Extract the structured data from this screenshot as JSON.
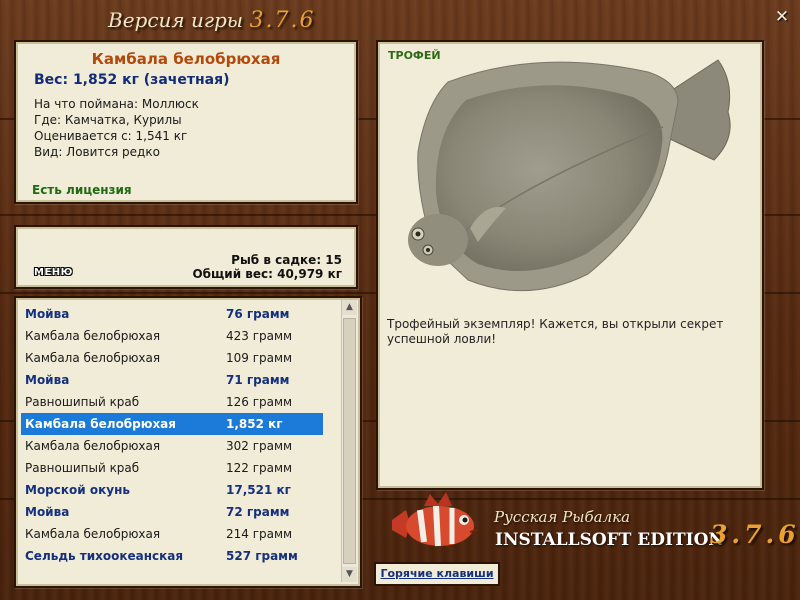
{
  "title": {
    "text": "Версия игры",
    "version": "3.7.6"
  },
  "fish_info": {
    "name": "Камбала белобрюхая",
    "weight_line": "Вес: 1,852 кг (зачетная)",
    "bait": "На что поймана: Моллюск",
    "location": "Где: Камчатка, Курилы",
    "rated_from": "Оценивается с: 1,541 кг",
    "kind": "Вид: Ловится редко",
    "license": "Есть лицензия"
  },
  "cage": {
    "fish_count": "Рыб в садке: 15",
    "total_weight": "Общий вес: 40,979 кг",
    "menu_label": "МЕНЮ"
  },
  "catch_list": [
    {
      "name": "Мойва",
      "weight": "76 грамм",
      "bold": true
    },
    {
      "name": "Камбала белобрюхая",
      "weight": "423 грамм",
      "bold": false
    },
    {
      "name": "Камбала белобрюхая",
      "weight": "109 грамм",
      "bold": false
    },
    {
      "name": "Мойва",
      "weight": "71 грамм",
      "bold": true
    },
    {
      "name": "Равношипый краб",
      "weight": "126 грамм",
      "bold": false
    },
    {
      "name": "Камбала белобрюхая",
      "weight": "1,852 кг",
      "bold": true,
      "selected": true
    },
    {
      "name": "Камбала белобрюхая",
      "weight": "302 грамм",
      "bold": false
    },
    {
      "name": "Равношипый краб",
      "weight": "122 грамм",
      "bold": false
    },
    {
      "name": "Морской окунь",
      "weight": "17,521 кг",
      "bold": true
    },
    {
      "name": "Мойва",
      "weight": "72 грамм",
      "bold": true
    },
    {
      "name": "Камбала белобрюхая",
      "weight": "214 грамм",
      "bold": false
    },
    {
      "name": "Сельдь тихоокеанская",
      "weight": "527 грамм",
      "bold": true
    }
  ],
  "trophy": {
    "label": "ТРОФЕЙ",
    "text": "Трофейный экземпляр! Кажется, вы открыли секрет успешной ловли!"
  },
  "branding": {
    "line1": "Русская Рыбалка",
    "line2": "INSTALLSOFT EDITION",
    "version": "3.7.6"
  },
  "hotkeys_label": "Горячие клавиши",
  "icons": {
    "close": "close-icon",
    "scroll_up": "scroll-up-icon",
    "scroll_down": "scroll-down-icon"
  }
}
